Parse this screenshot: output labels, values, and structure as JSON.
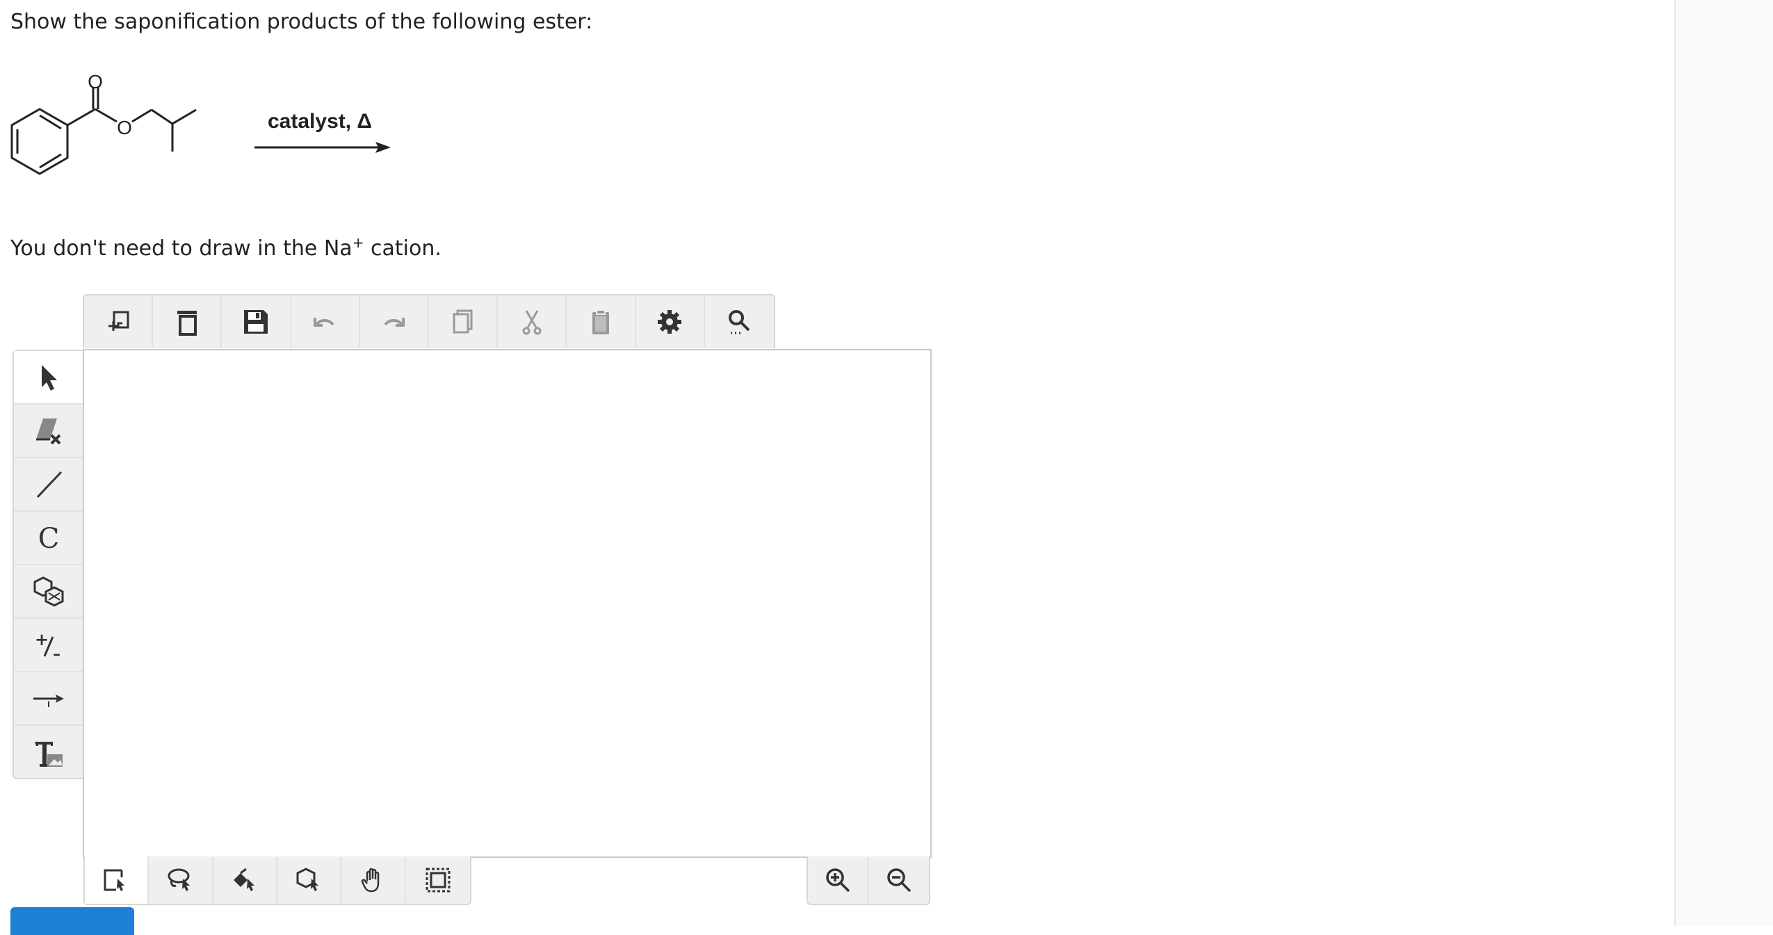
{
  "question": {
    "prompt": "Show the saponification products of the following ester:",
    "reaction_conditions": "catalyst, Δ",
    "note_prefix": "You don't need to draw in the Na",
    "note_superscript": "+",
    "note_suffix": " cation."
  },
  "molecule": {
    "carbonyl_oxygen": "O",
    "ester_oxygen": "O"
  },
  "editor": {
    "top_toolbar": [
      "new-icon",
      "clear-icon",
      "save-icon",
      "undo-icon",
      "redo-icon",
      "copy-icon",
      "cut-icon",
      "paste-icon",
      "settings-icon",
      "search-icon"
    ],
    "left_toolbar": [
      "select-arrow-icon",
      "eraser-icon",
      "bond-icon",
      "atom-icon",
      "ring-template-icon",
      "charge-icon",
      "reaction-arrow-icon",
      "text-icon"
    ],
    "left_toolbar_active": "select-arrow-icon",
    "atom_label": "C",
    "charge_label_plus": "+",
    "charge_label_minus": "–",
    "bottom_toolbar": [
      "rectangle-select-icon",
      "lasso-select-icon",
      "fragment-select-icon",
      "ring-select-icon",
      "pan-hand-icon",
      "fit-selection-icon"
    ],
    "zoom_toolbar": [
      "zoom-in-icon",
      "zoom-out-icon"
    ],
    "accent_color": "#1d7fd6"
  }
}
